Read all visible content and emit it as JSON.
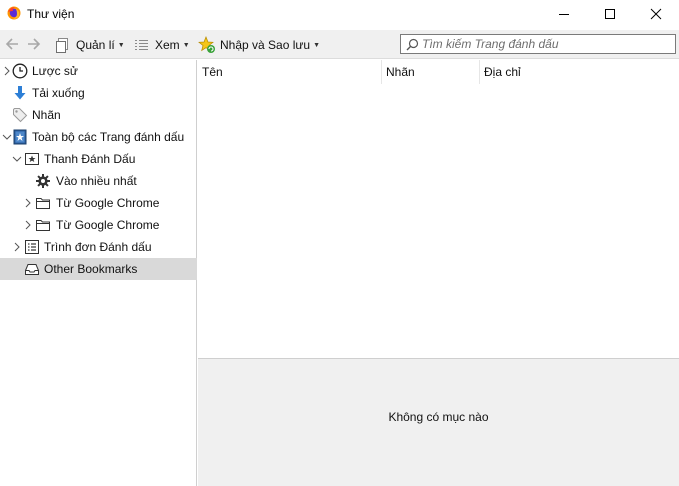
{
  "window": {
    "title": "Thư viện",
    "controls": [
      "minimize",
      "maximize",
      "close"
    ]
  },
  "toolbar": {
    "back_icon": "back-arrow-icon",
    "forward_icon": "forward-arrow-icon",
    "organize_label": "Quản lí",
    "views_label": "Xem",
    "import_label": "Nhập và Sao lưu",
    "search_placeholder": "Tìm kiếm Trang đánh dấu"
  },
  "sidebar": {
    "items": [
      {
        "label": "Lược sử",
        "icon": "clock-icon",
        "expandable": true,
        "expanded": false
      },
      {
        "label": "Tải xuống",
        "icon": "download-arrow-icon",
        "expandable": false
      },
      {
        "label": "Nhãn",
        "icon": "tag-icon",
        "expandable": false
      },
      {
        "label": "Toàn bộ các Trang đánh dấu",
        "icon": "bookmarks-book-icon",
        "expandable": true,
        "expanded": true
      },
      {
        "label": "Thanh Đánh Dấu",
        "icon": "star-toolbar-icon",
        "expandable": true,
        "expanded": true
      },
      {
        "label": "Vào nhiều nhất",
        "icon": "gear-icon",
        "expandable": false
      },
      {
        "label": "Từ Google Chrome",
        "icon": "folder-icon",
        "expandable": true,
        "expanded": false
      },
      {
        "label": "Từ Google Chrome",
        "icon": "folder-icon",
        "expandable": true,
        "expanded": false
      },
      {
        "label": "Trình đơn Đánh dấu",
        "icon": "menu-list-icon",
        "expandable": true,
        "expanded": false
      },
      {
        "label": "Other Bookmarks",
        "icon": "tray-icon",
        "expandable": false,
        "selected": true
      }
    ]
  },
  "table": {
    "columns": [
      "Tên",
      "Nhãn",
      "Địa chỉ"
    ],
    "rows": []
  },
  "details": {
    "empty_text": "Không có mục nào"
  },
  "colors": {
    "selected_row": "#d9d9d9",
    "toolbar_bg": "#f0f0f0",
    "detail_bg": "#f0f0f0"
  }
}
